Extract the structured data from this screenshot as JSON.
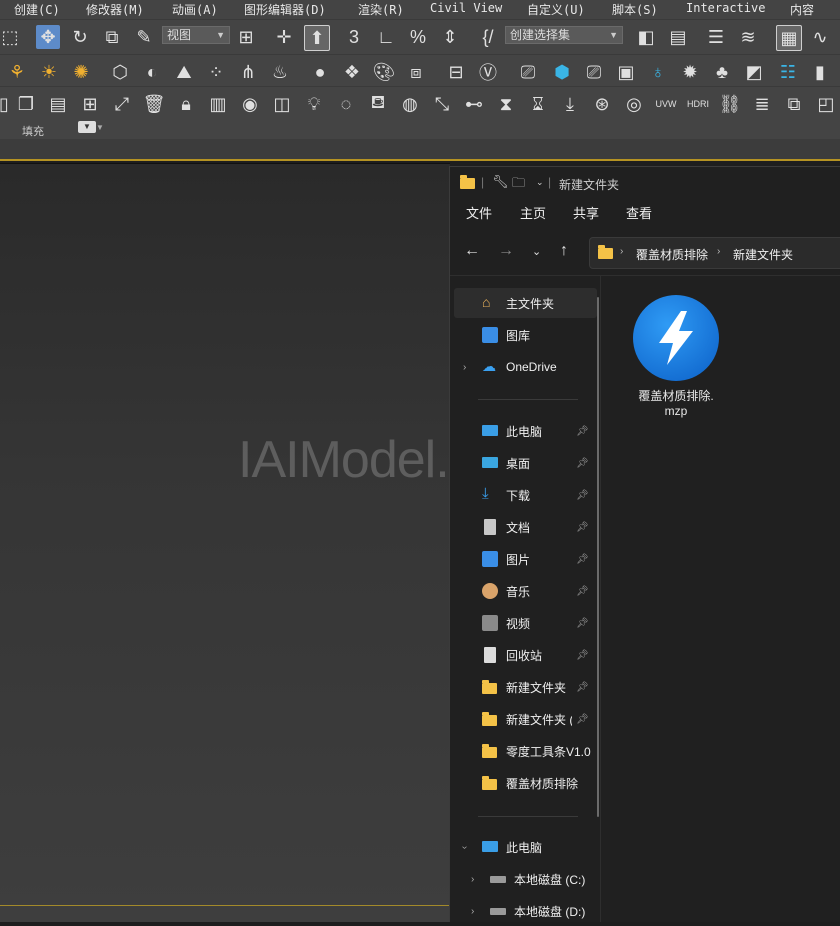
{
  "menu": [
    "创建(C)",
    "修改器(M)",
    "动画(A)",
    "图形编辑器(D)",
    "渲染(R)",
    "Civil View",
    "自定义(U)",
    "脚本(S)",
    "Interactive",
    "内容"
  ],
  "toolbar": {
    "view_dropdown": "视图",
    "selection_set_dropdown": "创建选择集"
  },
  "ribbon": {
    "fill_label": "填充"
  },
  "viewport": {
    "watermark": "IAIModel.com"
  },
  "explorer": {
    "title": "新建文件夹",
    "tabs": [
      "文件",
      "主页",
      "共享",
      "查看"
    ],
    "breadcrumb": [
      "覆盖材质排除",
      "新建文件夹"
    ],
    "nav": [
      {
        "label": "主文件夹",
        "icon": "home-icon",
        "pinned": false,
        "active": true
      },
      {
        "label": "图库",
        "icon": "gallery-icon",
        "pinned": false
      },
      {
        "label": "OneDrive",
        "icon": "cloud-icon",
        "pinned": false,
        "expand": true
      },
      {
        "label": "此电脑",
        "icon": "monitor-icon",
        "pinned": true
      },
      {
        "label": "桌面",
        "icon": "desktop-icon",
        "pinned": true
      },
      {
        "label": "下载",
        "icon": "download-icon",
        "pinned": true
      },
      {
        "label": "文档",
        "icon": "document-icon",
        "pinned": true
      },
      {
        "label": "图片",
        "icon": "picture-icon",
        "pinned": true
      },
      {
        "label": "音乐",
        "icon": "music-icon",
        "pinned": true
      },
      {
        "label": "视频",
        "icon": "video-icon",
        "pinned": true
      },
      {
        "label": "回收站",
        "icon": "recycle-bin-icon",
        "pinned": true
      },
      {
        "label": "新建文件夹",
        "icon": "folder-icon",
        "pinned": true
      },
      {
        "label": "新建文件夹 (",
        "icon": "folder-icon",
        "pinned": true
      },
      {
        "label": "零度工具条V1.0",
        "icon": "folder-icon",
        "pinned": false
      },
      {
        "label": "覆盖材质排除",
        "icon": "folder-icon",
        "pinned": false
      },
      {
        "label": "此电脑",
        "icon": "monitor-icon",
        "pinned": false,
        "expanded": true
      },
      {
        "label": "本地磁盘 (C:)",
        "icon": "drive-icon",
        "pinned": false,
        "expand": true
      },
      {
        "label": "本地磁盘 (D:)",
        "icon": "drive-icon",
        "pinned": false,
        "expand": true
      }
    ],
    "file": {
      "name_line1": "覆盖材质排除.",
      "name_line2": "mzp"
    }
  }
}
